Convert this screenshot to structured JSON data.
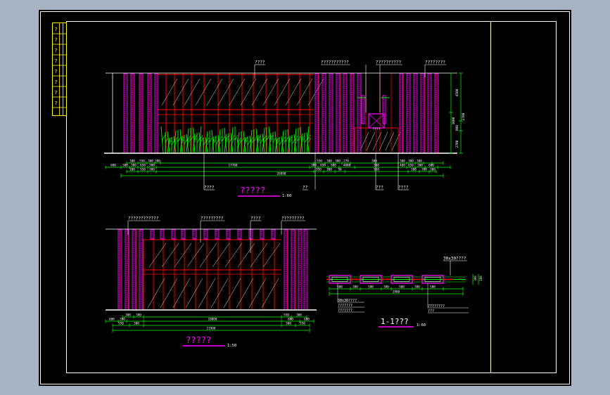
{
  "colors": {
    "background": "#a8b4c4",
    "paper": "#000000",
    "frame": "#ffffff",
    "titleblock": "#ffff00",
    "panel": "#ff00ff",
    "structure": "#ff0000",
    "glass": "#ffffff",
    "plants": "#00ff00",
    "dimension": "#00ff00",
    "leader": "#ffffff"
  },
  "icons": {
    "title_underline": "magenta-underline"
  },
  "titleblock": {
    "cells": [
      "?",
      "?",
      "?",
      "?",
      "?",
      "?",
      "?",
      "?"
    ]
  },
  "elevation1": {
    "title": "?????",
    "scale": "1:60",
    "callouts_top": [
      "????",
      "???????????",
      "??????????",
      "????????"
    ],
    "callouts_bottom": [
      "????",
      "??",
      "???",
      "????"
    ],
    "inner_callout": "????",
    "right_dims": [
      "4500",
      "2700",
      "1000",
      "800",
      "2700"
    ],
    "dims_row1": [
      "300",
      "550",
      "300",
      "300",
      "550",
      "300",
      "300",
      "270",
      "300",
      "300",
      "300",
      "300"
    ],
    "dims_row2": [
      "600",
      "300",
      "300",
      "650",
      "300",
      "17700",
      "300",
      "650",
      "600",
      "4800",
      "300",
      "400",
      "650",
      "300",
      "600"
    ],
    "dims_row3": [
      "300",
      "550",
      "300",
      "550",
      "300",
      "50",
      "550",
      "300",
      "300",
      "300"
    ],
    "total": "26990"
  },
  "elevation2": {
    "title": "?????",
    "scale": "1:50",
    "callouts_top": [
      "????????????",
      "?????????",
      "????",
      "?????????"
    ],
    "dims_row1": [
      "300",
      "300",
      "550",
      "550",
      "300"
    ],
    "dims_row2": [
      "600",
      "300",
      "10800",
      "800",
      "600"
    ],
    "dims_row3": [
      "550",
      "300",
      "300",
      "550"
    ],
    "total": "21900"
  },
  "section": {
    "title": "1-1???",
    "scale": "1:60",
    "callout_top": "30x30????",
    "callouts_left": [
      "30x30????",
      "???????",
      "???????"
    ],
    "callouts_right": [
      "????????",
      "???"
    ],
    "dims": [
      "500",
      "300",
      "500",
      "300",
      "500",
      "300",
      "500"
    ],
    "total": "2900",
    "side_dims": [
      "300",
      "180"
    ]
  }
}
